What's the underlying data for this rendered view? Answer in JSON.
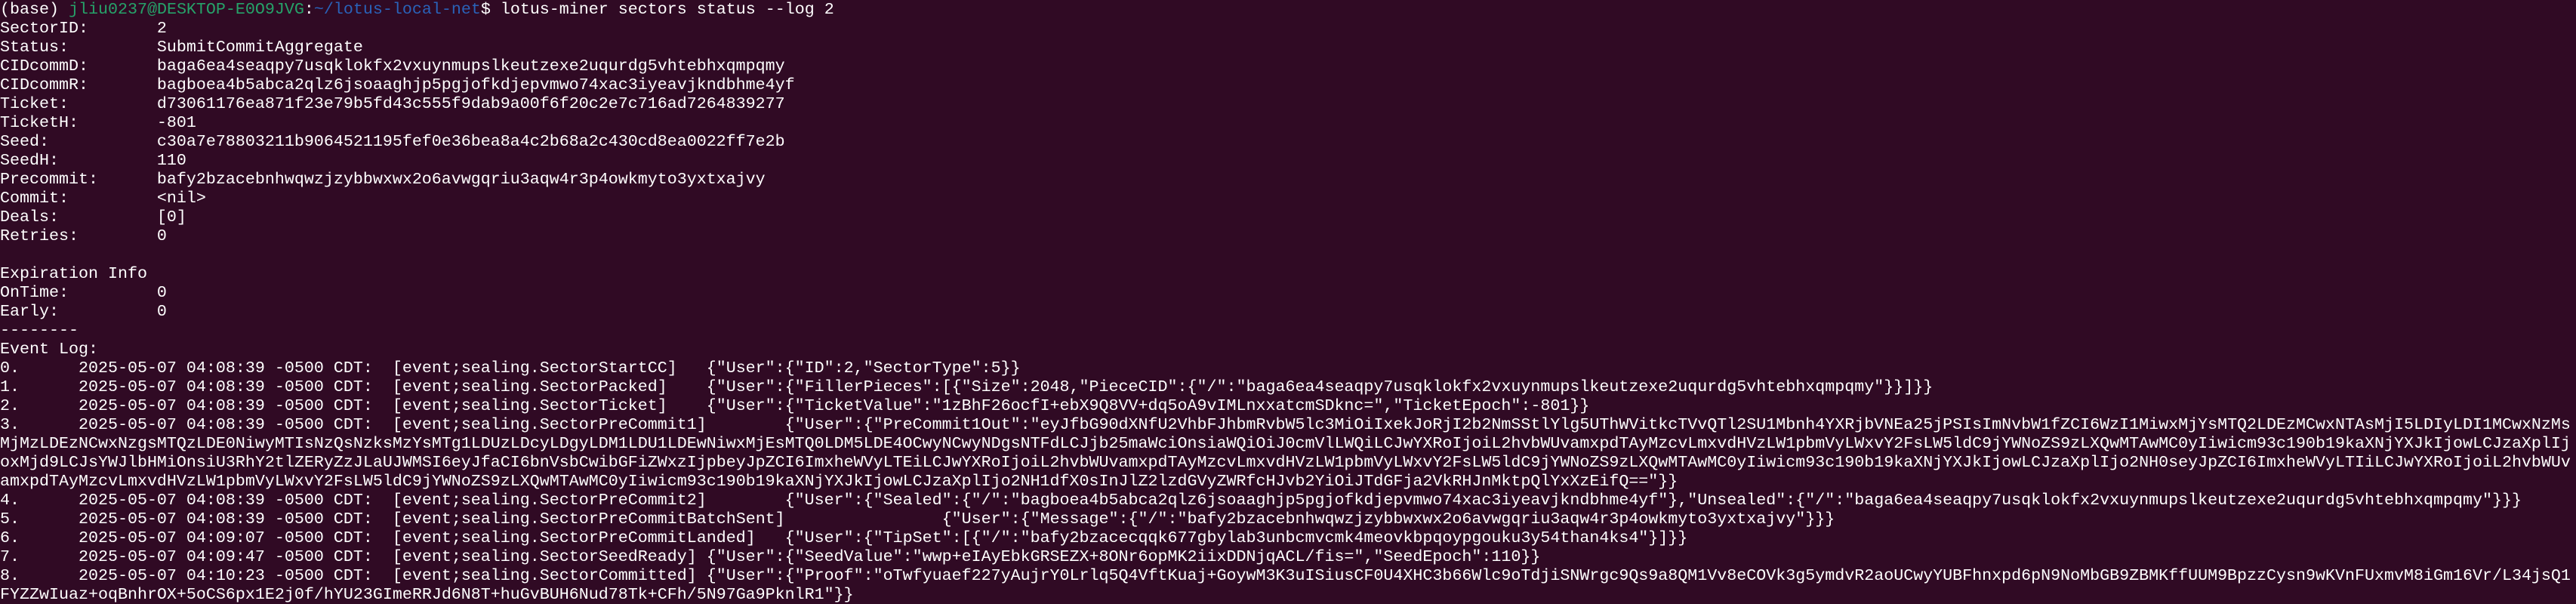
{
  "colors": {
    "background": "#300a24",
    "text": "#ffffff",
    "user_host": "#26a269",
    "path": "#2a62b8"
  },
  "prompt": {
    "env": "(base) ",
    "user_host": "jliu0237@DESKTOP-E0O9JVG",
    "colon": ":",
    "path": "~/lotus-local-net",
    "dollar": "$ ",
    "command": "lotus-miner sectors status --log 2"
  },
  "fields": [
    {
      "label": "SectorID:",
      "value": "2"
    },
    {
      "label": "Status:",
      "value": "SubmitCommitAggregate"
    },
    {
      "label": "CIDcommD:",
      "value": "baga6ea4seaqpy7usqklokfx2vxuynmupslkeutzexe2uqurdg5vhtebhxqmpqmy"
    },
    {
      "label": "CIDcommR:",
      "value": "bagboea4b5abca2qlz6jsoaaghjp5pgjofkdjepvmwo74xac3iyeavjkndbhme4yf"
    },
    {
      "label": "Ticket:",
      "value": "d73061176ea871f23e79b5fd43c555f9dab9a00f6f20c2e7c716ad7264839277"
    },
    {
      "label": "TicketH:",
      "value": "-801"
    },
    {
      "label": "Seed:",
      "value": "c30a7e78803211b9064521195fef0e36bea8a4c2b68a2c430cd8ea0022ff7e2b"
    },
    {
      "label": "SeedH:",
      "value": "110"
    },
    {
      "label": "Precommit:",
      "value": "bafy2bzacebnhwqwzjzybbwxwx2o6avwgqriu3aqw4r3p4owkmyto3yxtxajvy"
    },
    {
      "label": "Commit:",
      "value": "<nil>"
    },
    {
      "label": "Deals:",
      "value": "[0]"
    },
    {
      "label": "Retries:",
      "value": "0"
    }
  ],
  "expiration": {
    "title": "Expiration Info",
    "fields": [
      {
        "label": "OnTime:",
        "value": "0"
      },
      {
        "label": "Early:",
        "value": "0"
      }
    ]
  },
  "separator": "--------",
  "event_log": {
    "title": "Event Log:",
    "entries": [
      {
        "index": "0.",
        "time": "2025-05-07 04:08:39 -0500 CDT:",
        "event": "[event;sealing.SectorStartCC]",
        "data": "{\"User\":{\"ID\":2,\"SectorType\":5}}"
      },
      {
        "index": "1.",
        "time": "2025-05-07 04:08:39 -0500 CDT:",
        "event": "[event;sealing.SectorPacked]",
        "data": "{\"User\":{\"FillerPieces\":[{\"Size\":2048,\"PieceCID\":{\"/\":\"baga6ea4seaqpy7usqklokfx2vxuynmupslkeutzexe2uqurdg5vhtebhxqmpqmy\"}}]}}"
      },
      {
        "index": "2.",
        "time": "2025-05-07 04:08:39 -0500 CDT:",
        "event": "[event;sealing.SectorTicket]",
        "data": "{\"User\":{\"TicketValue\":\"1zBhF26ocfI+ebX9Q8VV+dq5oA9vIMLnxxatcmSDknc=\",\"TicketEpoch\":-801}}"
      },
      {
        "index": "3.",
        "time": "2025-05-07 04:08:39 -0500 CDT:",
        "event": "[event;sealing.SectorPreCommit1]",
        "data": "{\"User\":{\"PreCommit1Out\":\"eyJfbG90dXNfU2VhbFJhbmRvbW5lc3MiOiIxekJoRjI2b2NmSStlYlg5UThWVitkcTVvQTl2SU1Mbnh4YXRjbVNEa25jPSIsImNvbW1fZCI6WzI1MiwxMjYsMTQ2LDEzMCwxNTAsMjI5LDIyLDI1MCwxNzMsMjMzLDEzNCwxNzgsMTQzLDE0NiwyMTIsNzQsNzksMzYsMTg1LDUzLDcyLDgyLDM1LDU1LDEwNiwxMjEsMTQ0LDM5LDE4OCwyNCwyNDgsNTFdLCJjb25maWciOnsiaWQiOiJ0cmVlLWQiLCJwYXRoIjoiL2hvbWUvamxpdTAyMzcvLmxvdHVzLW1pbmVyLWxvY2FsLW5ldC9jYWNoZS9zLXQwMTAwMC0yIiwicm93c190b19kaXNjYXJkIjowLCJzaXplIjoxMjd9LCJsYWJlbHMiOnsiU3RhY2tlZERyZzJLaUJWMSI6eyJfaCI6bnVsbCwibGFiZWxzIjpbeyJpZCI6ImxheWVyLTEiLCJwYXRoIjoiL2hvbWUvamxpdTAyMzcvLmxvdHVzLW1pbmVyLWxvY2FsLW5ldC9jYWNoZS9zLXQwMTAwMC0yIiwicm93c190b19kaXNjYXJkIjowLCJzaXplIjo2NH0seyJpZCI6ImxheWVyLTIiLCJwYXRoIjoiL2hvbWUvamxpdTAyMzcvLmxvdHVzLW1pbmVyLWxvY2FsLW5ldC9jYWNoZS9zLXQwMTAwMC0yIiwicm93c190b19kaXNjYXJkIjowLCJzaXplIjo2NH1dfX0sInJlZ2lzdGVyZWRfcHJvb2YiOiJTdGFja2VkRHJnMktpQlYxXzEifQ==\"}}"
      },
      {
        "index": "4.",
        "time": "2025-05-07 04:08:39 -0500 CDT:",
        "event": "[event;sealing.SectorPreCommit2]",
        "data": "{\"User\":{\"Sealed\":{\"/\":\"bagboea4b5abca2qlz6jsoaaghjp5pgjofkdjepvmwo74xac3iyeavjkndbhme4yf\"},\"Unsealed\":{\"/\":\"baga6ea4seaqpy7usqklokfx2vxuynmupslkeutzexe2uqurdg5vhtebhxqmpqmy\"}}}"
      },
      {
        "index": "5.",
        "time": "2025-05-07 04:08:39 -0500 CDT:",
        "event": "[event;sealing.SectorPreCommitBatchSent]",
        "data": "{\"User\":{\"Message\":{\"/\":\"bafy2bzacebnhwqwzjzybbwxwx2o6avwgqriu3aqw4r3p4owkmyto3yxtxajvy\"}}}"
      },
      {
        "index": "6.",
        "time": "2025-05-07 04:09:07 -0500 CDT:",
        "event": "[event;sealing.SectorPreCommitLanded]",
        "data": "{\"User\":{\"TipSet\":[{\"/\":\"bafy2bzacecqqk677gbylab3unbcmvcmk4meovkbpqoypgouku3y54than4ks4\"}]}}"
      },
      {
        "index": "7.",
        "time": "2025-05-07 04:09:47 -0500 CDT:",
        "event": "[event;sealing.SectorSeedReady]",
        "data": "{\"User\":{\"SeedValue\":\"wwp+eIAyEbkGRSEZX+8ONr6opMK2iixDDNjqACL/fis=\",\"SeedEpoch\":110}}"
      },
      {
        "index": "8.",
        "time": "2025-05-07 04:10:23 -0500 CDT:",
        "event": "[event;sealing.SectorCommitted]",
        "data": "{\"User\":{\"Proof\":\"oTwfyuaef227yAujrY0Lrlq5Q4VftKuaj+GoywM3K3uISiusCF0U4XHC3b66Wlc9oTdjiSNWrgc9Qs9a8QM1Vv8eCOVk3g5ymdvR2aoUCwyYUBFhnxpd6pN9NoMbGB9ZBMKffUUM9BpzzCysn9wKVnFUxmvM8iGm16Vr/L34jsQ1FYZZwIuaz+oqBnhrOX+5oCS6px1E2j0f/hYU23GImeRRJd6N8T+huGvBUH6Nud78Tk+CFh/5N97Ga9PknlR1\"}}"
      }
    ]
  }
}
